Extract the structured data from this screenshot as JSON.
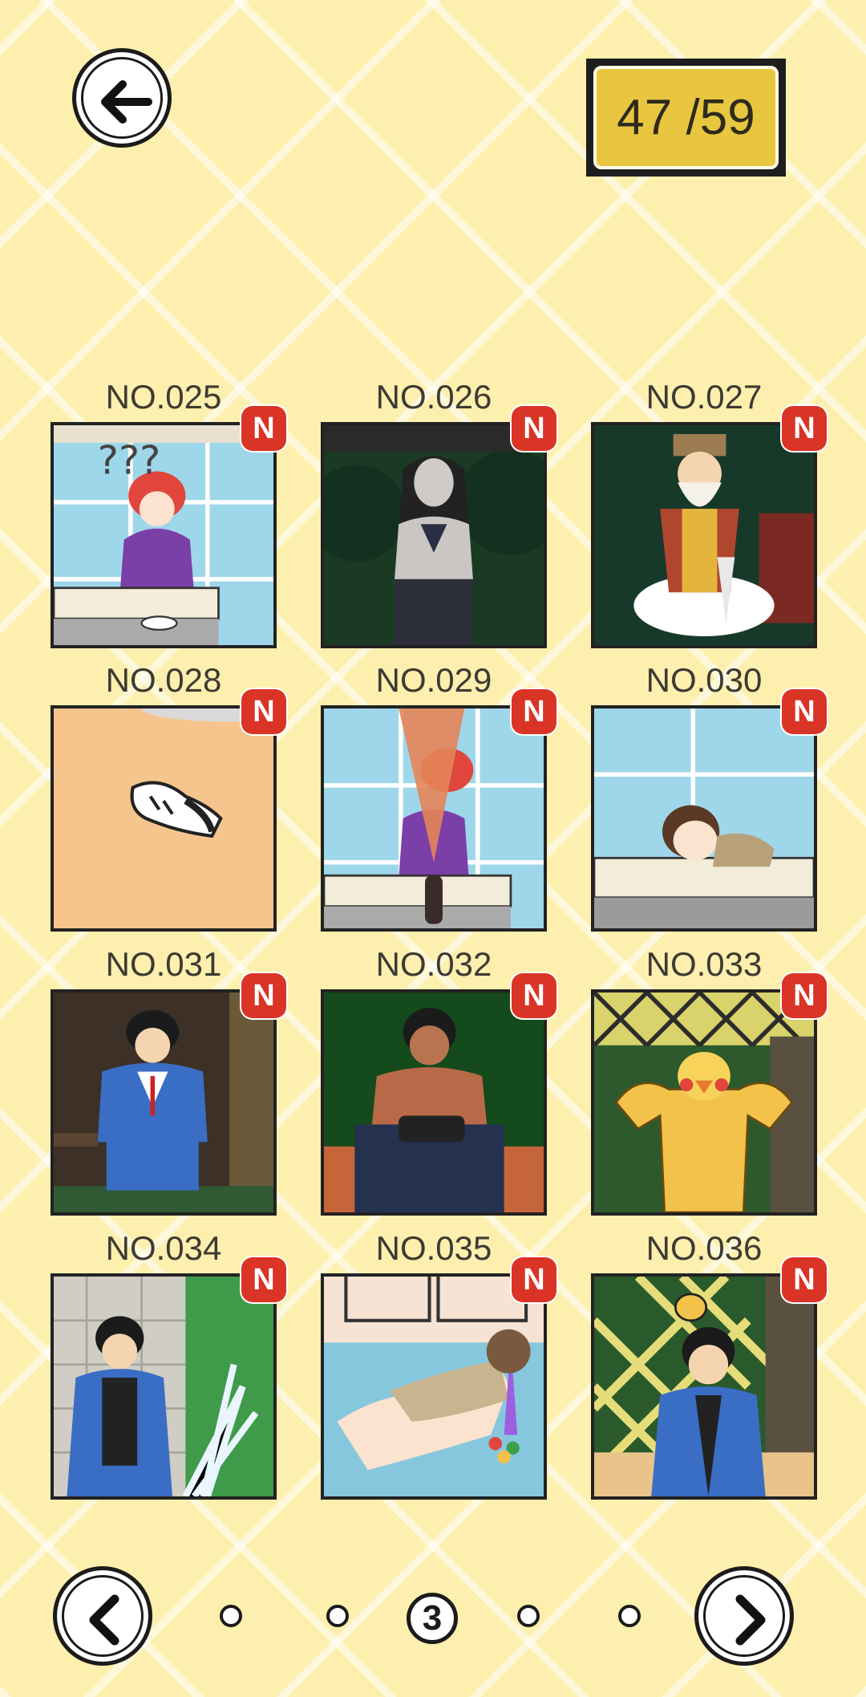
{
  "header": {
    "back_icon": "back-arrow-icon",
    "progress_text": "47 /59"
  },
  "badge_text": "N",
  "cards": [
    {
      "label": "NO.025",
      "scene": "red-haired-girl-at-sink"
    },
    {
      "label": "NO.026",
      "scene": "dark-haired-girl-in-forest"
    },
    {
      "label": "NO.027",
      "scene": "old-man-on-cloud"
    },
    {
      "label": "NO.028",
      "scene": "sneaker-on-floor"
    },
    {
      "label": "NO.029",
      "scene": "girl-with-soda-fountain"
    },
    {
      "label": "NO.030",
      "scene": "boy-resting-on-wall"
    },
    {
      "label": "NO.031",
      "scene": "boy-in-tracksuit-on-bench"
    },
    {
      "label": "NO.032",
      "scene": "boy-with-game-console"
    },
    {
      "label": "NO.033",
      "scene": "muscular-duck"
    },
    {
      "label": "NO.034",
      "scene": "boy-splashed-by-water"
    },
    {
      "label": "NO.035",
      "scene": "girl-vomiting-rainbow"
    },
    {
      "label": "NO.036",
      "scene": "crying-boy-with-bee"
    }
  ],
  "pagination": {
    "prev_icon": "chevron-left-icon",
    "next_icon": "chevron-right-icon",
    "current_page": "3",
    "total_pages": 5
  }
}
